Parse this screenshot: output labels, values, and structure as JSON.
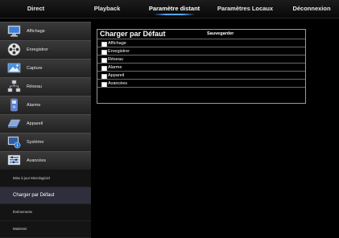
{
  "topnav": {
    "tabs": [
      {
        "label": "Direct",
        "active": false
      },
      {
        "label": "Playback",
        "active": false
      },
      {
        "label": "Paramètre distant",
        "active": true
      },
      {
        "label": "Paramètres Locaux",
        "active": false
      },
      {
        "label": "Déconnexion",
        "active": false
      }
    ]
  },
  "sidebar": {
    "items": [
      {
        "label": "Affichage",
        "icon": "monitor-icon"
      },
      {
        "label": "Enregistrer",
        "icon": "film-reel-icon"
      },
      {
        "label": "Capture",
        "icon": "capture-icon"
      },
      {
        "label": "Réseau",
        "icon": "network-icon"
      },
      {
        "label": "Alarme",
        "icon": "alarm-icon"
      },
      {
        "label": "Appareil",
        "icon": "hard-drive-icon"
      },
      {
        "label": "Système",
        "icon": "system-info-icon"
      },
      {
        "label": "Avancées",
        "icon": "advanced-tools-icon"
      }
    ],
    "subitems": [
      {
        "label": "Mise à jour Micrologiciel",
        "selected": false
      },
      {
        "label": "Charger par Défaut",
        "selected": true
      },
      {
        "label": "Événements",
        "selected": false
      },
      {
        "label": "Maintenir",
        "selected": false
      }
    ]
  },
  "panel": {
    "title": "Charger par Défaut",
    "save_label": "Sauvegarder",
    "options": [
      {
        "label": "Affichage",
        "checked": false
      },
      {
        "label": "Enregistrer",
        "checked": false
      },
      {
        "label": "Réseau",
        "checked": false
      },
      {
        "label": "Alarme",
        "checked": false
      },
      {
        "label": "Appareil",
        "checked": false
      },
      {
        "label": "Avancées",
        "checked": false
      }
    ]
  },
  "colors": {
    "accent": "#5aa6ff",
    "background": "#000000",
    "sidebar": "#1e1e1e"
  }
}
